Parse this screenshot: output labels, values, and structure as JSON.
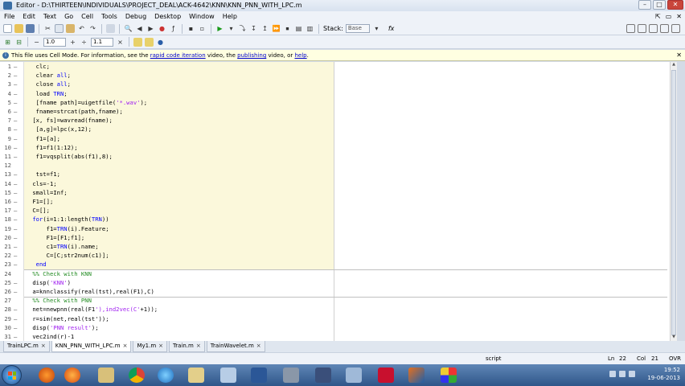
{
  "window": {
    "title": "Editor - D:\\THIRTEEN\\INDIVIDUALS\\PROJECT_DEAL\\ACK-4642\\KNN\\KNN_PNN_WITH_LPC.m"
  },
  "menu": [
    "File",
    "Edit",
    "Text",
    "Go",
    "Cell",
    "Tools",
    "Debug",
    "Desktop",
    "Window",
    "Help"
  ],
  "toolbar": {
    "cell_value_1": "1.0",
    "cell_value_2": "1.1",
    "stack_label": "Stack:",
    "stack_value": "Base",
    "fx_label": "fx"
  },
  "infobar": {
    "text_before": "This file uses Cell Mode. For information, see the ",
    "link1": "rapid code iteration",
    "text_mid1": " video, the ",
    "link2": "publishing",
    "text_mid2": " video, or ",
    "link3": "help",
    "text_end": "."
  },
  "code_lines": [
    {
      "n": "1",
      "d": "–",
      "t": "  clc;"
    },
    {
      "n": "2",
      "d": "–",
      "t": "  clear all;"
    },
    {
      "n": "3",
      "d": "–",
      "t": "  close all;"
    },
    {
      "n": "4",
      "d": "–",
      "t": "  load TRN;"
    },
    {
      "n": "5",
      "d": "–",
      "t": "  [fname path]=uigetfile('*.wav');"
    },
    {
      "n": "6",
      "d": "–",
      "t": "  fname=strcat(path,fname);"
    },
    {
      "n": "7",
      "d": "–",
      "t": " [x, fs]=wavread(fname);"
    },
    {
      "n": "8",
      "d": "–",
      "t": "  [a,g]=lpc(x,12);"
    },
    {
      "n": "9",
      "d": "–",
      "t": "  f1=[a];"
    },
    {
      "n": "10",
      "d": "–",
      "t": "  f1=f1(1:12);"
    },
    {
      "n": "11",
      "d": "–",
      "t": "  f1=vqsplit(abs(f1),8);"
    },
    {
      "n": "12",
      "d": "",
      "t": ""
    },
    {
      "n": "13",
      "d": "–",
      "t": "  tst=f1;"
    },
    {
      "n": "14",
      "d": "–",
      "t": " cls=-1;"
    },
    {
      "n": "15",
      "d": "–",
      "t": " small=Inf;"
    },
    {
      "n": "16",
      "d": "–",
      "t": " F1=[];"
    },
    {
      "n": "17",
      "d": "–",
      "t": " C=[];"
    },
    {
      "n": "18",
      "d": "–",
      "t": " for(i=1:1:length(TRN))"
    },
    {
      "n": "19",
      "d": "–",
      "t": "     f1=TRN(i).Feature;"
    },
    {
      "n": "20",
      "d": "–",
      "t": "     F1=[F1;f1];"
    },
    {
      "n": "21",
      "d": "–",
      "t": "     c1=TRN(i).name;"
    },
    {
      "n": "22",
      "d": "–",
      "t": "     C=[C;str2num(c1)];"
    },
    {
      "n": "23",
      "d": "–",
      "t": "  end"
    },
    {
      "n": "24",
      "d": "",
      "t": " %% Check with KNN"
    },
    {
      "n": "25",
      "d": "–",
      "t": " disp('KNN')"
    },
    {
      "n": "26",
      "d": "–",
      "t": " a=knnclassify(real(tst),real(F1),C)"
    },
    {
      "n": "27",
      "d": "",
      "t": " %% Check with PNN"
    },
    {
      "n": "28",
      "d": "–",
      "t": " net=newpnn(real(F1'),ind2vec(C'+1));"
    },
    {
      "n": "29",
      "d": "–",
      "t": " r=sim(net,real(tst'));"
    },
    {
      "n": "30",
      "d": "–",
      "t": " disp('PNN result');"
    },
    {
      "n": "31",
      "d": "–",
      "t": " vec2ind(r)-1"
    }
  ],
  "tabs": [
    {
      "label": "TrainLPC.m",
      "active": false
    },
    {
      "label": "KNN_PNN_WITH_LPC.m",
      "active": true
    },
    {
      "label": "My1.m",
      "active": false
    },
    {
      "label": "Train.m",
      "active": false
    },
    {
      "label": "TrainWavelet.m",
      "active": false
    }
  ],
  "status": {
    "mode": "script",
    "ln_label": "Ln",
    "ln": "22",
    "col_label": "Col",
    "col": "21",
    "ovr": "OVR"
  },
  "clock": {
    "time": "19:52",
    "date": "19-06-2013"
  },
  "colors": {
    "cell_highlight": "#fbf8db",
    "keyword": "#0000ff",
    "string": "#a020f0",
    "comment": "#228b22"
  },
  "taskbar_icons": [
    "start-orb",
    "ie-icon",
    "media-player-icon",
    "firefox-icon",
    "folder-icon",
    "chrome-icon",
    "ie-blue-icon",
    "explorer-icon",
    "generic-app-icon",
    "word-icon",
    "usb-icon",
    "infinity-icon",
    "image-icon",
    "acrobat-icon",
    "matlab-icon",
    "grid-app-icon"
  ]
}
